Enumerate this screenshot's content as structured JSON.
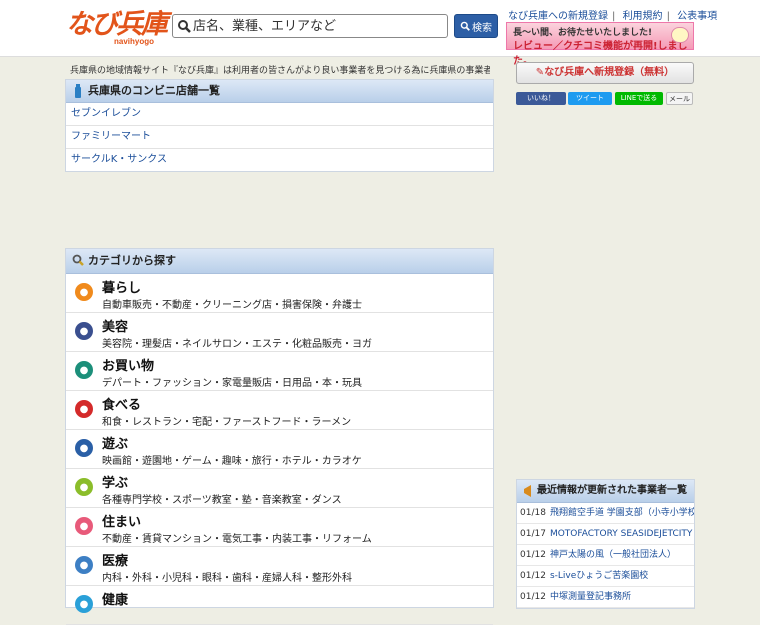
{
  "header": {
    "logo_text": "なび兵庫",
    "logo_sub": "navihyogo",
    "search_placeholder": "店名、業種、エリアなど",
    "search_button": "検索",
    "links": [
      "なび兵庫への新規登録",
      "利用規約",
      "公表事項"
    ],
    "banner_line1": "長〜い間、お待たせいたしました!",
    "banner_line2": "レビュー／クチコミ機能が再開!しました。"
  },
  "intro_text": "兵庫県の地域情報サイト『なび兵庫』は利用者の皆さんがより良い事業者を見つける為に兵庫県の事業者情報を無料...",
  "convenience": {
    "title": "兵庫県のコンビニ店舗一覧",
    "items": [
      "セブンイレブン",
      "ファミリーマート",
      "サークルK・サンクス"
    ]
  },
  "categories": {
    "title": "カテゴリから探す",
    "items": [
      {
        "title": "暮らし",
        "sub": "自動車販売・不動産・クリーニング店・損害保険・弁護士",
        "color": "#f08a1c",
        "icon": "house-icon"
      },
      {
        "title": "美容",
        "sub": "美容院・理髪店・ネイルサロン・エステ・化粧品販売・ヨガ",
        "color": "#3a4f8f",
        "icon": "beauty-icon"
      },
      {
        "title": "お買い物",
        "sub": "デパート・ファッション・家電量販店・日用品・本・玩具",
        "color": "#1c8f7a",
        "icon": "shopping-bag-icon"
      },
      {
        "title": "食べる",
        "sub": "和食・レストラン・宅配・ファーストフード・ラーメン",
        "color": "#d42a2a",
        "icon": "food-bowl-icon"
      },
      {
        "title": "遊ぶ",
        "sub": "映画館・遊園地・ゲーム・趣味・旅行・ホテル・カラオケ",
        "color": "#2a5fa6",
        "icon": "play-icon"
      },
      {
        "title": "学ぶ",
        "sub": "各種専門学校・スポーツ教室・塾・音楽教室・ダンス",
        "color": "#8bbd2a",
        "icon": "pencil-icon"
      },
      {
        "title": "住まい",
        "sub": "不動産・賃貸マンション・電気工事・内装工事・リフォーム",
        "color": "#e85a7a",
        "icon": "home-icon"
      },
      {
        "title": "医療",
        "sub": "内科・外科・小児科・眼科・歯科・産婦人科・整形外科",
        "color": "#3d7fc4",
        "icon": "medical-icon"
      },
      {
        "title": "健康",
        "sub": "",
        "color": "#2aa0d8",
        "icon": "health-icon"
      }
    ]
  },
  "sidebar": {
    "register_button": "なび兵庫へ新規登録（無料）",
    "share": {
      "like": "いいね！",
      "tweet": "ツイート",
      "line": "LINEで送る",
      "mail": "メール"
    },
    "news": {
      "title": "最近情報が更新された事業者一覧",
      "items": [
        {
          "date": "01/18",
          "text": "飛翔館空手道 学園支部（小寺小学校空手"
        },
        {
          "date": "01/17",
          "text": "MOTOFACTORY SEASIDEJETCITY"
        },
        {
          "date": "01/12",
          "text": "神戸太陽の風（一般社団法人）"
        },
        {
          "date": "01/12",
          "text": "s-Liveひょうご苦楽園校"
        },
        {
          "date": "01/12",
          "text": "中塚測量登記事務所"
        }
      ]
    }
  }
}
